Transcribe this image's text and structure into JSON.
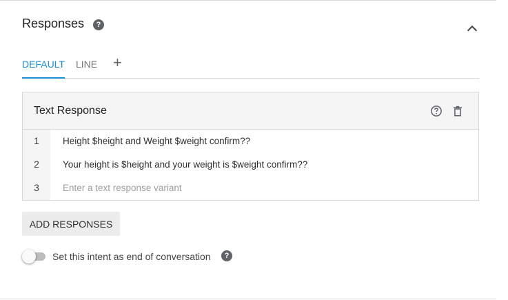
{
  "section": {
    "title": "Responses",
    "help_glyph": "?",
    "collapse_icon": "chevron-up-icon"
  },
  "tabs": [
    {
      "label": "DEFAULT",
      "active": true
    },
    {
      "label": "LINE",
      "active": false
    }
  ],
  "add_tab_glyph": "+",
  "card": {
    "title": "Text Response",
    "help_icon": "help-outline-icon",
    "delete_icon": "trash-icon",
    "rows": [
      {
        "num": "1",
        "text": "Height $height and Weight $weight  confirm??"
      },
      {
        "num": "2",
        "text": "Your height is $height and your weight is $weight confirm??"
      },
      {
        "num": "3",
        "placeholder": "Enter a text response variant"
      }
    ]
  },
  "add_button_label": "ADD RESPONSES",
  "toggle": {
    "label": "Set this intent as end of conversation",
    "on": false,
    "help_glyph": "?"
  },
  "colors": {
    "accent": "#1a8dd6",
    "card_header": "#f5f5f5",
    "border": "#d9d9d9"
  }
}
